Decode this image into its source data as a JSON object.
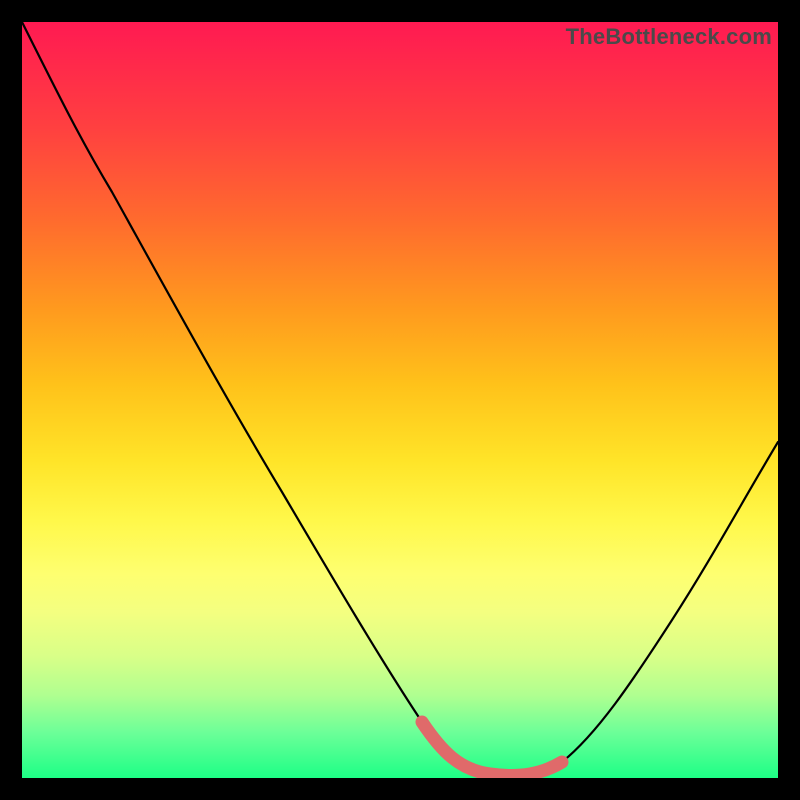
{
  "watermark": "TheBottleneck.com",
  "colors": {
    "background": "#000000",
    "curve": "#000000",
    "highlight": "#e06a6a",
    "gradient_top": "#ff1a52",
    "gradient_bottom": "#1dff86"
  },
  "chart_data": {
    "type": "line",
    "title": "",
    "xlabel": "",
    "ylabel": "",
    "xlim": [
      0,
      100
    ],
    "ylim": [
      0,
      100
    ],
    "grid": false,
    "legend": false,
    "series": [
      {
        "name": "bottleneck-curve",
        "x": [
          0,
          5,
          10,
          15,
          20,
          25,
          30,
          35,
          40,
          45,
          50,
          52,
          55,
          58,
          62,
          65,
          68,
          70,
          74,
          78,
          82,
          86,
          90,
          95,
          100
        ],
        "y": [
          100,
          92,
          83,
          74,
          65,
          56,
          47,
          38,
          30,
          22,
          14,
          10,
          5,
          2,
          0,
          0,
          0,
          1,
          5,
          12,
          20,
          28,
          36,
          47,
          58
        ]
      }
    ],
    "annotations": [
      {
        "name": "highlight-segment",
        "style": "thick-pink",
        "x": [
          52,
          55,
          58,
          62,
          65,
          68,
          70
        ],
        "y": [
          10,
          5,
          2,
          0,
          0,
          0,
          1
        ]
      }
    ]
  }
}
